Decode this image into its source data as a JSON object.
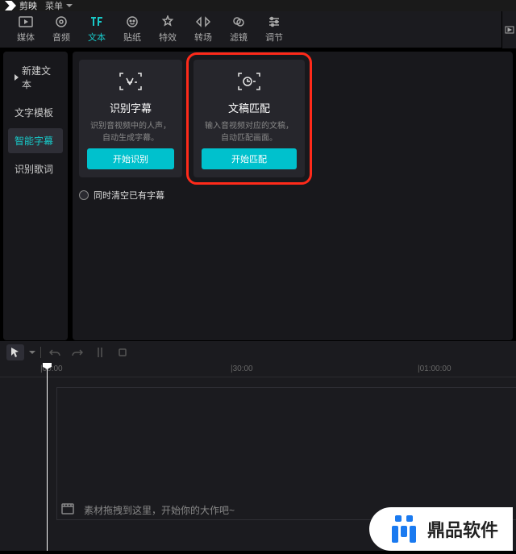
{
  "titlebar": {
    "app_name": "剪映",
    "menu_label": "菜单"
  },
  "tabs": [
    {
      "id": "media",
      "label": "媒体"
    },
    {
      "id": "audio",
      "label": "音频"
    },
    {
      "id": "text",
      "label": "文本"
    },
    {
      "id": "sticker",
      "label": "贴纸"
    },
    {
      "id": "effect",
      "label": "特效"
    },
    {
      "id": "trans",
      "label": "转场"
    },
    {
      "id": "filter",
      "label": "滤镜"
    },
    {
      "id": "adjust",
      "label": "调节"
    }
  ],
  "active_tab": "text",
  "sidebar": {
    "items": [
      {
        "id": "new-text",
        "label": "新建文本",
        "has_caret": true
      },
      {
        "id": "template",
        "label": "文字模板"
      },
      {
        "id": "smart-sub",
        "label": "智能字幕"
      },
      {
        "id": "lyrics",
        "label": "识别歌词"
      }
    ],
    "active": "smart-sub"
  },
  "cards": [
    {
      "id": "recognize",
      "title": "识别字幕",
      "desc": "识别音视频中的人声，自动生成字幕。",
      "button": "开始识别",
      "highlighted": false
    },
    {
      "id": "match",
      "title": "文稿匹配",
      "desc": "输入音视频对应的文稿，自动匹配画面。",
      "button": "开始匹配",
      "highlighted": true
    }
  ],
  "checkbox": {
    "label": "同时清空已有字幕"
  },
  "ruler": {
    "marks": [
      {
        "pos": 50,
        "label": "|00:00"
      },
      {
        "pos": 286,
        "label": "|30:00"
      },
      {
        "pos": 518,
        "label": "|01:00:00"
      }
    ]
  },
  "timeline_hint": "素材拖拽到这里，开始你的大作吧~",
  "watermark": "鼎品软件"
}
